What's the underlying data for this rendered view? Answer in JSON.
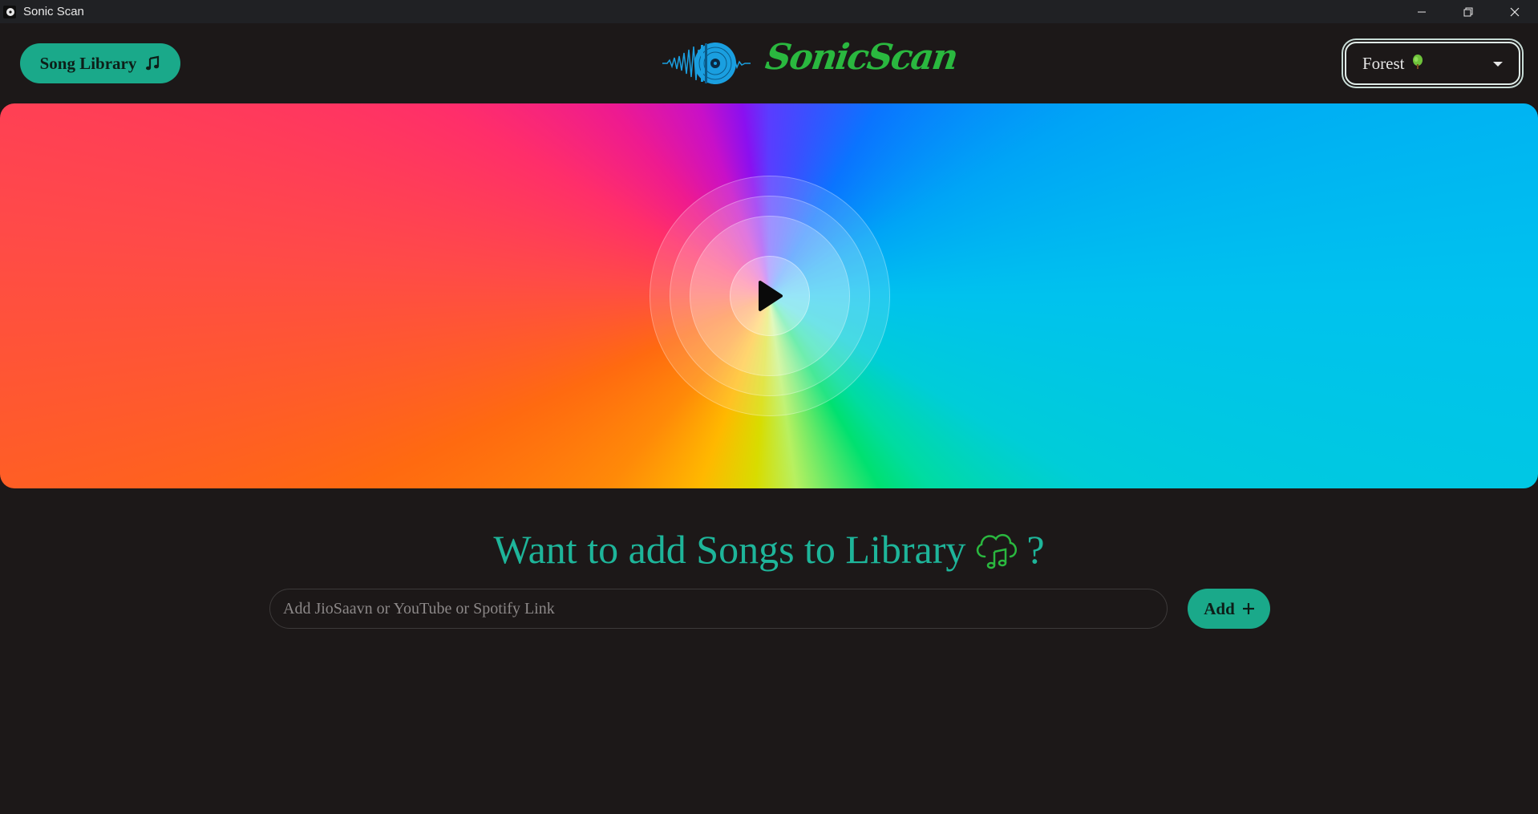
{
  "window": {
    "title": "Sonic Scan",
    "controls": [
      "minimize",
      "restore",
      "close"
    ]
  },
  "header": {
    "library_button_label": "Song Library",
    "library_button_icon": "music-note-icon",
    "logo_text": "SonicScan",
    "theme": {
      "selected": "Forest",
      "icon": "tree-icon"
    }
  },
  "hero": {
    "play_icon": "play-icon"
  },
  "add_section": {
    "heading_prefix": "Want to add Songs to Library",
    "heading_icon": "cloud-music-icon",
    "heading_suffix": "?",
    "input_placeholder": "Add JioSaavn or YouTube or Spotify Link",
    "input_value": "",
    "add_button_label": "Add",
    "add_button_icon": "plus-icon"
  },
  "colors": {
    "accent": "#1aa98a",
    "headline": "#1eb59a",
    "logo_green": "#2ab83f",
    "background": "#1c1818"
  }
}
